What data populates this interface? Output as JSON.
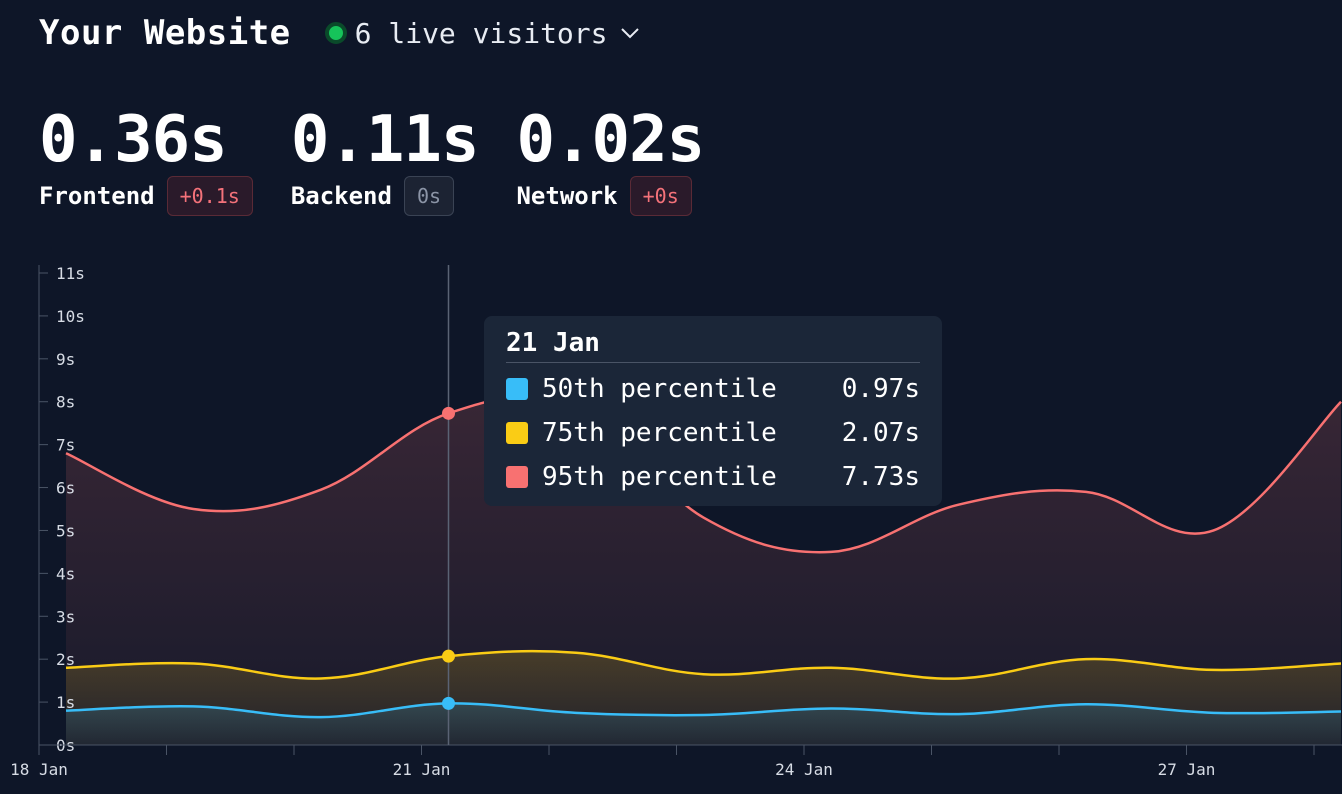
{
  "header": {
    "title": "Your Website",
    "live_visitors": "6 live visitors"
  },
  "metrics": [
    {
      "value": "0.36s",
      "label": "Frontend",
      "delta": "+0.1s",
      "delta_type": "bad"
    },
    {
      "value": "0.11s",
      "label": "Backend",
      "delta": "0s",
      "delta_type": "neutral"
    },
    {
      "value": "0.02s",
      "label": "Network",
      "delta": "+0s",
      "delta_type": "bad"
    }
  ],
  "tooltip": {
    "title": "21 Jan",
    "rows": [
      {
        "name": "50th percentile",
        "value": "0.97s",
        "color": "#38bdf8"
      },
      {
        "name": "75th percentile",
        "value": "2.07s",
        "color": "#facc15"
      },
      {
        "name": "95th percentile",
        "value": "7.73s",
        "color": "#f87171"
      }
    ]
  },
  "chart_data": {
    "type": "area",
    "x": [
      "18 Jan",
      "19 Jan",
      "20 Jan",
      "21 Jan",
      "22 Jan",
      "23 Jan",
      "24 Jan",
      "25 Jan",
      "26 Jan",
      "27 Jan",
      "28 Jan"
    ],
    "x_tick_labels": [
      "18 Jan",
      "21 Jan",
      "24 Jan",
      "27 Jan"
    ],
    "y_tick_labels": [
      "0s",
      "1s",
      "2s",
      "3s",
      "4s",
      "5s",
      "6s",
      "7s",
      "8s",
      "9s",
      "10s",
      "11s"
    ],
    "ylim": [
      0,
      11
    ],
    "highlight_x": "21 Jan",
    "series": [
      {
        "name": "50th percentile",
        "color": "#38bdf8",
        "values": [
          0.8,
          0.9,
          0.65,
          0.97,
          0.75,
          0.7,
          0.85,
          0.72,
          0.95,
          0.75,
          0.78
        ]
      },
      {
        "name": "75th percentile",
        "color": "#facc15",
        "values": [
          1.8,
          1.9,
          1.55,
          2.07,
          2.15,
          1.65,
          1.8,
          1.55,
          2.0,
          1.75,
          1.9
        ]
      },
      {
        "name": "95th percentile",
        "color": "#f87171",
        "values": [
          6.8,
          5.5,
          5.95,
          7.73,
          7.9,
          5.3,
          4.5,
          5.6,
          5.9,
          5.0,
          8.0
        ]
      }
    ],
    "grid": false
  }
}
